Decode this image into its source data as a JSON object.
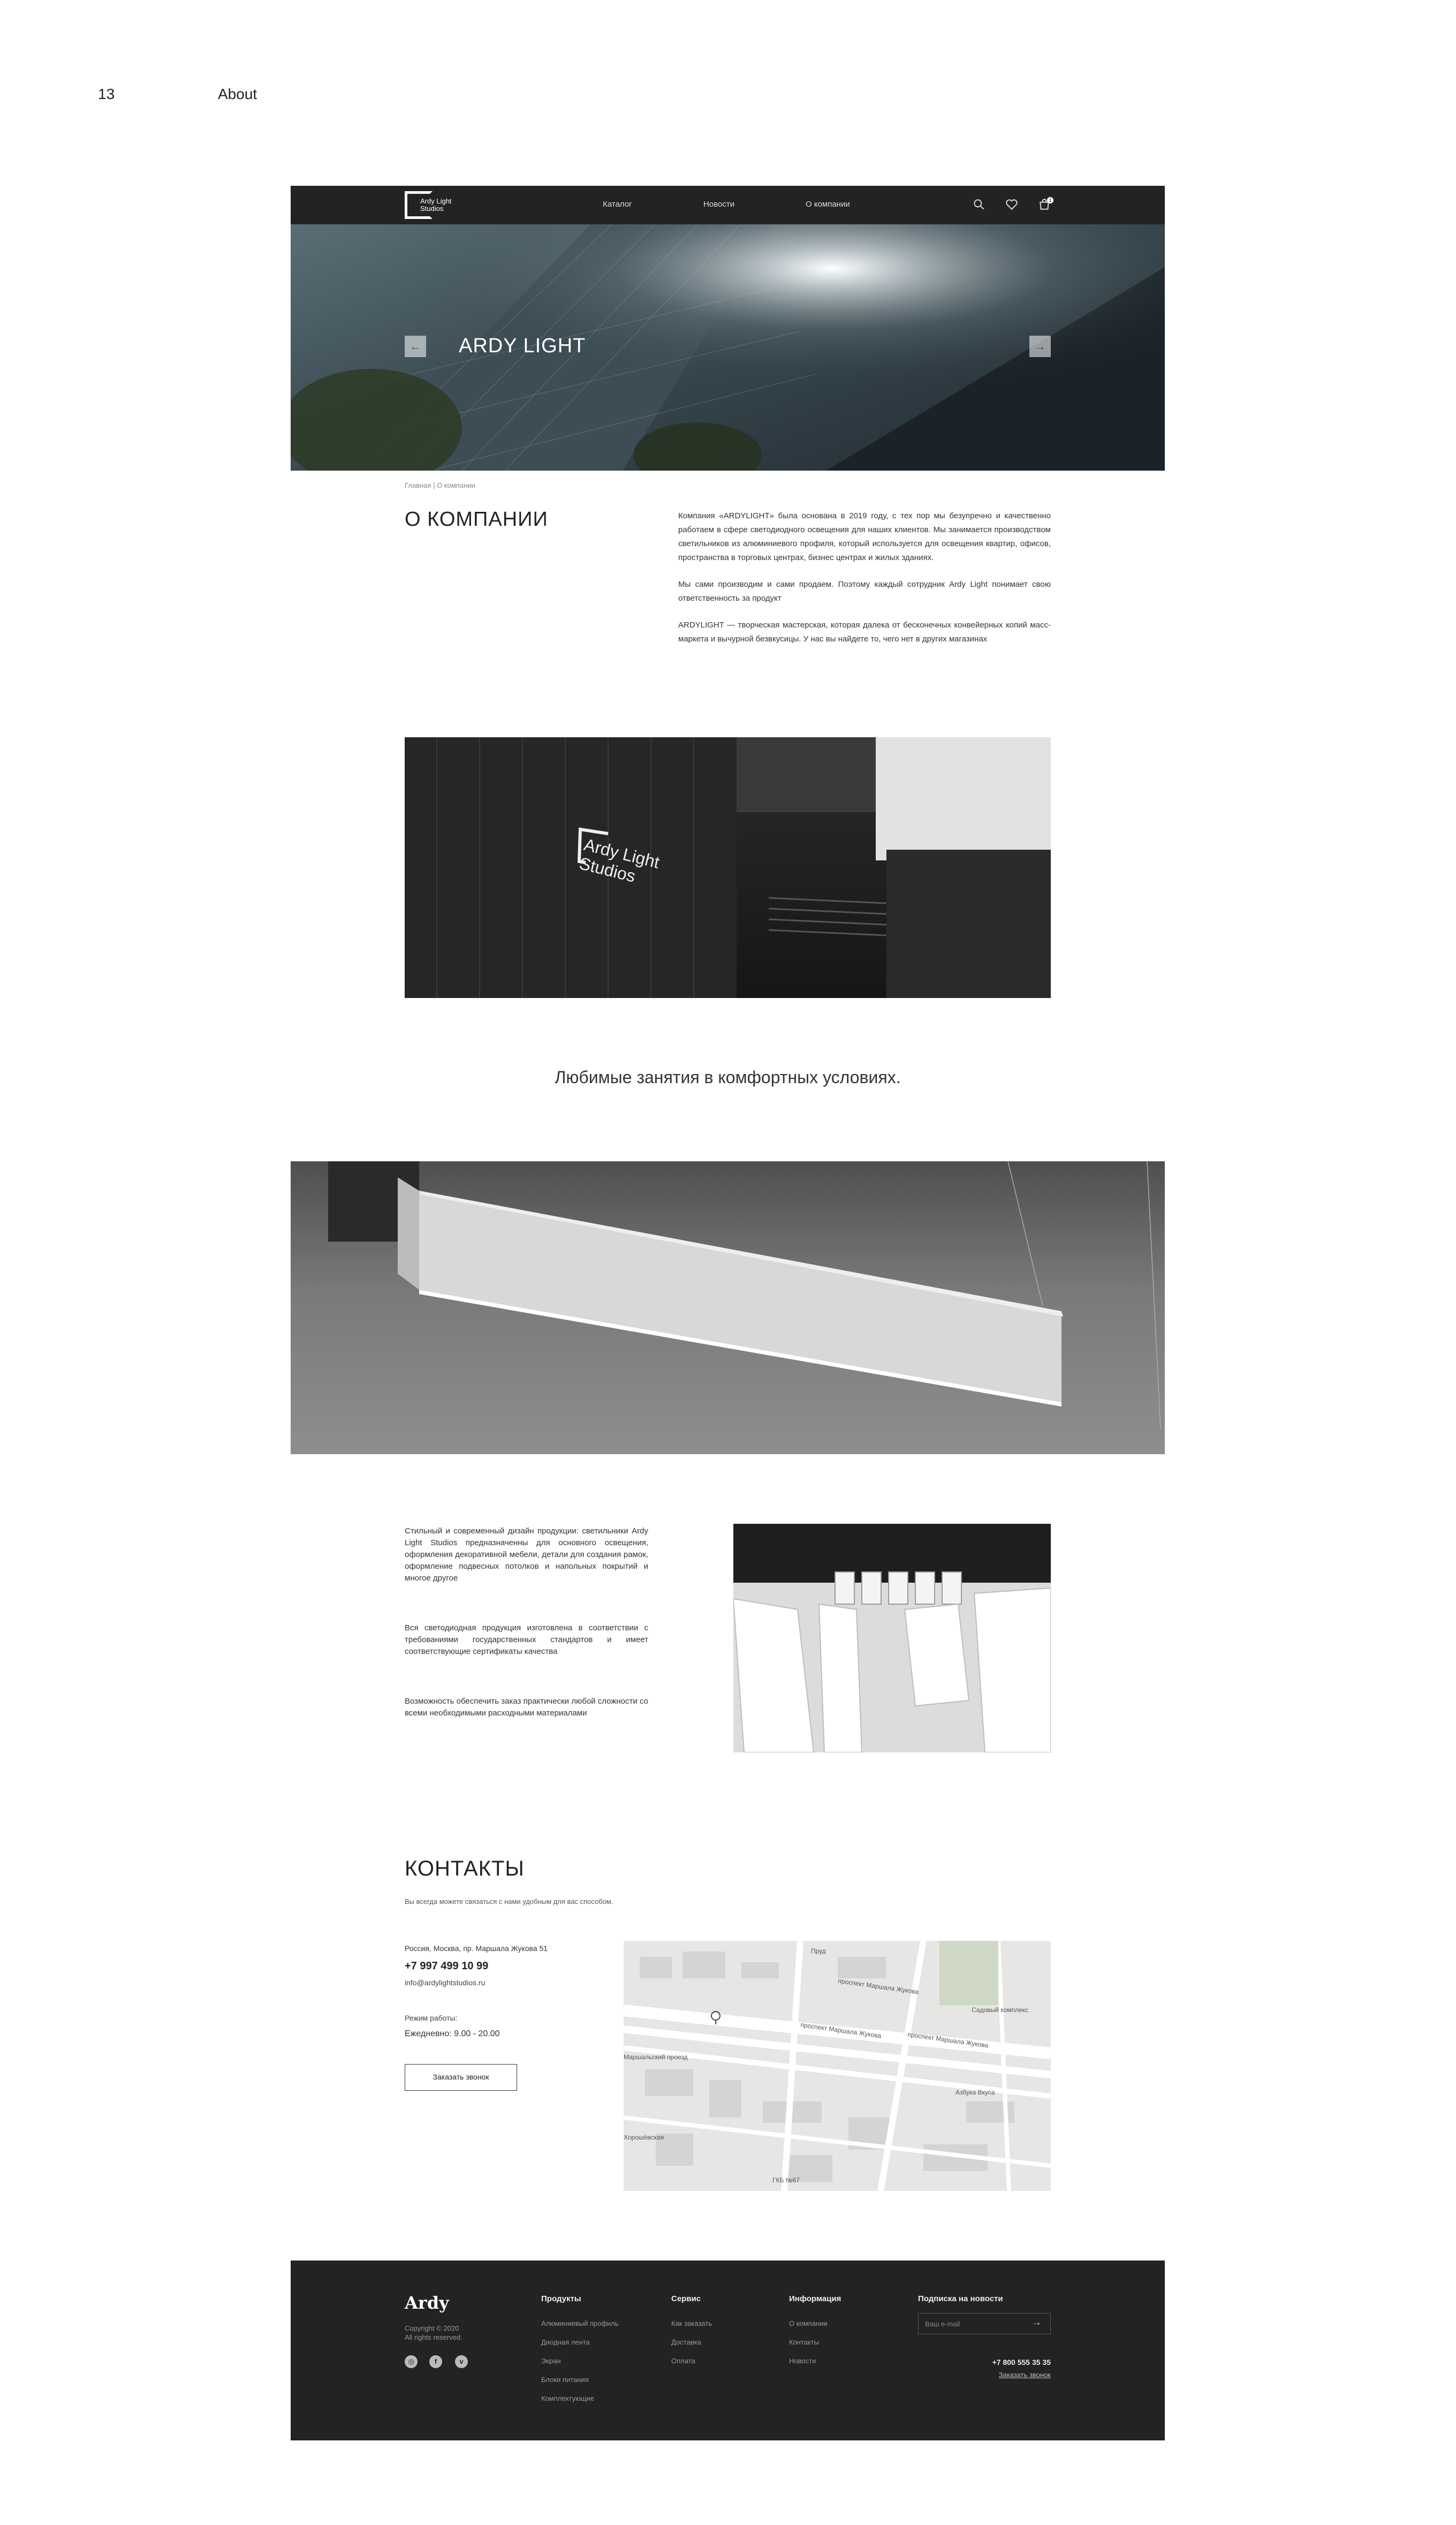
{
  "page": {
    "number": "13",
    "title": "About"
  },
  "header": {
    "logo_text_line1": "Ardy Light",
    "logo_text_line2": "Studios",
    "nav": [
      "Каталог",
      "Новости",
      "О компании"
    ],
    "cart_count": "1"
  },
  "hero": {
    "title": "ARDY LIGHT",
    "prev_arrow": "←",
    "next_arrow": "→"
  },
  "breadcrumb": "Главная | О компании",
  "about": {
    "title": "О КОМПАНИИ",
    "paragraphs": [
      "Компания «ARDYLIGHT» была основана в 2019 году, с тех пор мы безупречно и качественно работаем в сфере светодиодного освещения для наших клиентов. Мы занимается производством светильников из алюминиевого профиля, который используется для освещения квартир, офисов, пространства в торговых центрах, бизнес центрах и жилых зданиях.",
      "Мы сами производим и сами продаем. Поэтому каждый сотрудник Ardy Light понимает свою ответственность за продукт",
      "ARDYLIGHT — творческая мастерская, которая далека от бесконечных конвейерных копий масс-маркета и вычурной безвкусицы. У нас вы найдете то, чего нет в других магазинах"
    ]
  },
  "building_sign": {
    "line1": "Ardy Light",
    "line2": "Studios"
  },
  "tagline": "Любимые занятия в комфортных условиях.",
  "features": [
    "Стильный и современный дизайн продукции: светильники Ardy Light Studios предназначенны для основного освещения, оформления декоративной мебели, детали для создания рамок, оформление подвесных потолков и напольных покрытий и многое другое",
    "Вся светодиодная продукция изготовлена в соответствии с требованиями государственных стандартов и имеет соответствующие сертификаты качества",
    "Возможность обеспечить заказ практически любой сложности со всеми необходимыми расходными материалами"
  ],
  "contacts": {
    "title": "КОНТАКТЫ",
    "subtitle": "Вы всегда можете связаться с нами удобным для вас способом.",
    "address": "Россия, Москва, пр. Маршала Жукова 51",
    "phone": "+7 997 499 10 99",
    "email": "info@ardylightstudios.ru",
    "hours_label": "Режим работы:",
    "hours": "Ежедневно: 9.00 - 20.00",
    "callback_button": "Заказать звонок"
  },
  "map": {
    "labels": [
      "проспект Маршала Жукова",
      "проспект Маршала Жукова",
      "проспект Маршала Жукова",
      "Садовый комплекс",
      "Азбука Вкуса",
      "Хорошёвская",
      "Маршальский проезд",
      "ГКБ №67",
      "Пруд"
    ]
  },
  "footer": {
    "logo": "Ardy",
    "copyright_line1": "Copyright © 2020",
    "copyright_line2": "All rights reserved.",
    "columns": [
      {
        "title": "Продукты",
        "links": [
          "Алюминиевый профиль",
          "Диодная лента",
          "Экран",
          "Блоки питания",
          "Комплектующие"
        ]
      },
      {
        "title": "Сервис",
        "links": [
          "Как заказать",
          "Доставка",
          "Оплата"
        ]
      },
      {
        "title": "Информация",
        "links": [
          "О компании",
          "Контакты",
          "Новости"
        ]
      }
    ],
    "subscribe_title": "Подписка на новости",
    "subscribe_placeholder": "Ваш e-mail",
    "phone": "+7 800 555 35 35",
    "callback": "Заказать звонок"
  }
}
